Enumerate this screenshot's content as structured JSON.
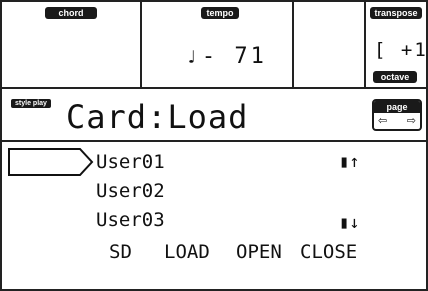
{
  "header": {
    "chord_label": "chord",
    "tempo_label": "tempo",
    "tempo_note": "♩",
    "tempo_value": "- 71",
    "transpose_label": "transpose",
    "transpose_value": "[ +1",
    "octave_label": "octave"
  },
  "mode": {
    "style_play_label": "style play",
    "title": "Card:Load",
    "page_label": "page",
    "page_prev_icon": "page-left-arrow-icon",
    "page_next_icon": "page-right-arrow-icon"
  },
  "file_list": {
    "items": [
      "User01",
      "User02",
      "User03"
    ],
    "scroll_up": "▮↑",
    "scroll_down": "▮↓"
  },
  "function_buttons": [
    "SD",
    "LOAD",
    "OPEN",
    "CLOSE"
  ]
}
